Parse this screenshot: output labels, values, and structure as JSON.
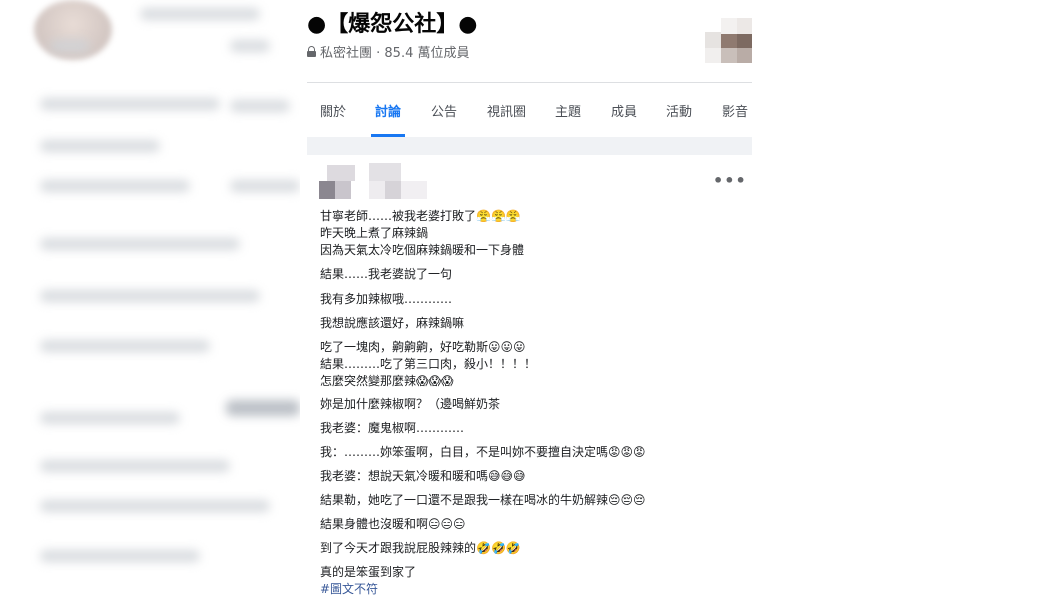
{
  "group": {
    "title": "●【爆怨公社】●",
    "subtitle": "私密社團 · 85.4 萬位成員"
  },
  "tabs": [
    {
      "label": "關於"
    },
    {
      "label": "討論",
      "active": true
    },
    {
      "label": "公告"
    },
    {
      "label": "視訊圈"
    },
    {
      "label": "主題"
    },
    {
      "label": "成員"
    },
    {
      "label": "活動"
    },
    {
      "label": "影音"
    }
  ],
  "post": {
    "more_label": "•••",
    "lines": [
      "甘寧老師……被我老婆打敗了😤😤😤",
      "昨天晚上煮了麻辣鍋",
      "因為天氣太冷吃個麻辣鍋暖和一下身體",
      "結果……我老婆說了一句",
      "我有多加辣椒哦…………",
      "我想說應該還好，麻辣鍋嘛",
      "吃了一塊肉，齁齁齁，好吃勒斯😛😛😛",
      "結果………吃了第三口肉，殺小！！！！",
      "怎麼突然變那麼辣😱😱😱",
      "妳是加什麼辣椒啊？（邊喝鮮奶茶",
      "我老婆：魔鬼椒啊…………",
      "我：………妳笨蛋啊，白目，不是叫妳不要擅自決定嗎😡😡😡",
      "我老婆：想說天氣冷暖和暖和嗎😅😅😅",
      "結果勒，她吃了一口還不是跟我一樣在喝冰的牛奶解辣😔😔😔",
      "結果身體也沒暖和啊😑😑😑",
      "到了今天才跟我說屁股辣辣的🤣🤣🤣",
      "真的是笨蛋到家了"
    ],
    "hashtag": "#圖文不符"
  },
  "colors": {
    "accent": "#1877f2",
    "text": "#1c1e21",
    "secondary": "#65676b",
    "band": "#f0f2f5"
  }
}
